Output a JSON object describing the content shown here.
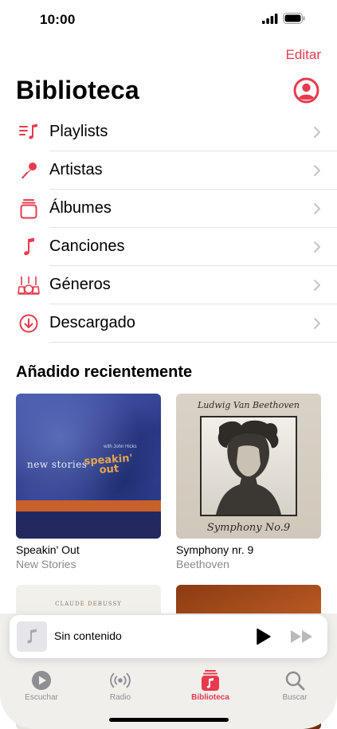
{
  "status_bar": {
    "time": "10:00",
    "icons": [
      "signal-icon",
      "battery-icon"
    ]
  },
  "header": {
    "edit_label": "Editar",
    "title": "Biblioteca",
    "account_icon": "account-circle-icon"
  },
  "menu": {
    "items": [
      {
        "label": "Playlists",
        "icon": "playlists-icon"
      },
      {
        "label": "Artistas",
        "icon": "microphone-icon"
      },
      {
        "label": "Álbumes",
        "icon": "albums-icon"
      },
      {
        "label": "Canciones",
        "icon": "music-note-icon"
      },
      {
        "label": "Géneros",
        "icon": "genres-icon"
      },
      {
        "label": "Descargado",
        "icon": "download-circle-icon"
      }
    ]
  },
  "recent": {
    "title": "Añadido recientemente",
    "albums": [
      {
        "title": "Speakin' Out",
        "artist": "New Stories",
        "cover_text": [
          "new stories",
          "speakin'",
          "out"
        ]
      },
      {
        "title": "Symphony nr. 9",
        "artist": "Beethoven",
        "cover_text": [
          "Ludwig Van Beethoven",
          "Symphony No.9"
        ]
      },
      {
        "title": "",
        "artist": "",
        "cover_text": [
          "CLAUDE DEBUSSY"
        ]
      },
      {
        "title": "",
        "artist": "",
        "cover_text": []
      }
    ]
  },
  "mini_player": {
    "title": "Sin contenido"
  },
  "tabs": [
    {
      "label": "Escuchar",
      "icon": "play-circle-icon",
      "active": false
    },
    {
      "label": "Radio",
      "icon": "radio-icon",
      "active": false
    },
    {
      "label": "Biblioteca",
      "icon": "library-icon",
      "active": true
    },
    {
      "label": "Buscar",
      "icon": "search-icon",
      "active": false
    }
  ],
  "colors": {
    "accent": "#e83a4d",
    "separator": "#e4e4e6",
    "secondary_text": "#8a8a8e",
    "tab_inactive": "#8e8e93",
    "tab_bar_bg": "#f1efec"
  }
}
